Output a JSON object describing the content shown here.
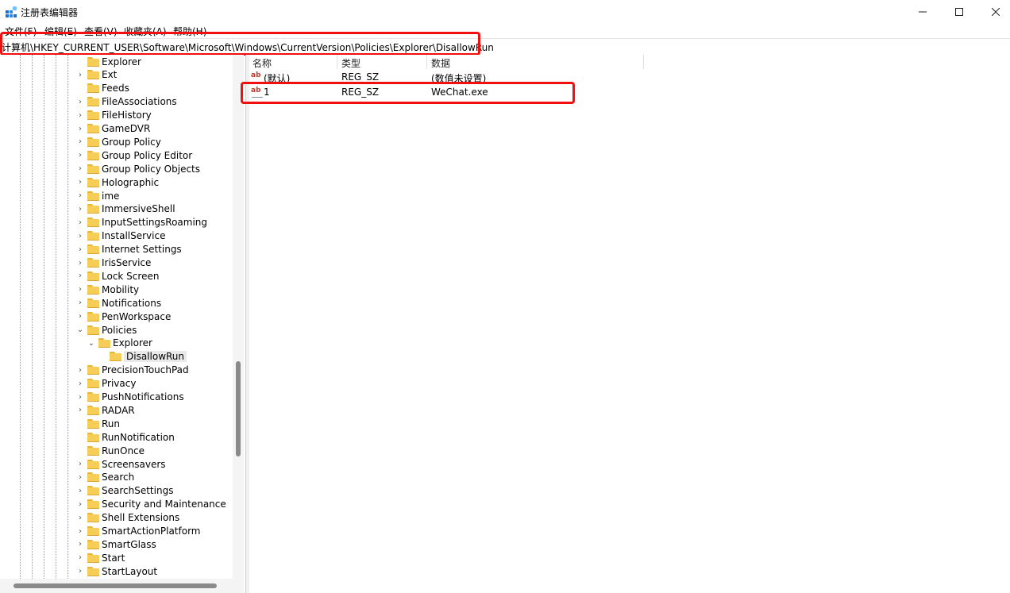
{
  "window": {
    "title": "注册表编辑器"
  },
  "menu": [
    "文件(F)",
    "编辑(E)",
    "查看(V)",
    "收藏夹(A)",
    "帮助(H)"
  ],
  "address": {
    "path": "计算机\\HKEY_CURRENT_USER\\Software\\Microsoft\\Windows\\CurrentVersion\\Policies\\Explorer\\DisallowRun"
  },
  "tree": [
    {
      "label": "Explorer",
      "level": 0,
      "expander": "none"
    },
    {
      "label": "Ext",
      "level": 0,
      "expander": "collapsed"
    },
    {
      "label": "Feeds",
      "level": 0,
      "expander": "none"
    },
    {
      "label": "FileAssociations",
      "level": 0,
      "expander": "collapsed"
    },
    {
      "label": "FileHistory",
      "level": 0,
      "expander": "collapsed"
    },
    {
      "label": "GameDVR",
      "level": 0,
      "expander": "collapsed"
    },
    {
      "label": "Group Policy",
      "level": 0,
      "expander": "collapsed"
    },
    {
      "label": "Group Policy Editor",
      "level": 0,
      "expander": "collapsed"
    },
    {
      "label": "Group Policy Objects",
      "level": 0,
      "expander": "collapsed"
    },
    {
      "label": "Holographic",
      "level": 0,
      "expander": "collapsed"
    },
    {
      "label": "ime",
      "level": 0,
      "expander": "collapsed"
    },
    {
      "label": "ImmersiveShell",
      "level": 0,
      "expander": "collapsed"
    },
    {
      "label": "InputSettingsRoaming",
      "level": 0,
      "expander": "collapsed"
    },
    {
      "label": "InstallService",
      "level": 0,
      "expander": "collapsed"
    },
    {
      "label": "Internet Settings",
      "level": 0,
      "expander": "collapsed"
    },
    {
      "label": "IrisService",
      "level": 0,
      "expander": "collapsed"
    },
    {
      "label": "Lock Screen",
      "level": 0,
      "expander": "collapsed"
    },
    {
      "label": "Mobility",
      "level": 0,
      "expander": "collapsed"
    },
    {
      "label": "Notifications",
      "level": 0,
      "expander": "collapsed"
    },
    {
      "label": "PenWorkspace",
      "level": 0,
      "expander": "collapsed"
    },
    {
      "label": "Policies",
      "level": 0,
      "expander": "expanded"
    },
    {
      "label": "Explorer",
      "level": 1,
      "expander": "expanded"
    },
    {
      "label": "DisallowRun",
      "level": 2,
      "expander": "none",
      "selected": true
    },
    {
      "label": "PrecisionTouchPad",
      "level": 0,
      "expander": "collapsed"
    },
    {
      "label": "Privacy",
      "level": 0,
      "expander": "collapsed"
    },
    {
      "label": "PushNotifications",
      "level": 0,
      "expander": "collapsed"
    },
    {
      "label": "RADAR",
      "level": 0,
      "expander": "collapsed"
    },
    {
      "label": "Run",
      "level": 0,
      "expander": "none"
    },
    {
      "label": "RunNotification",
      "level": 0,
      "expander": "none"
    },
    {
      "label": "RunOnce",
      "level": 0,
      "expander": "none"
    },
    {
      "label": "Screensavers",
      "level": 0,
      "expander": "collapsed"
    },
    {
      "label": "Search",
      "level": 0,
      "expander": "collapsed"
    },
    {
      "label": "SearchSettings",
      "level": 0,
      "expander": "collapsed"
    },
    {
      "label": "Security and Maintenance",
      "level": 0,
      "expander": "collapsed"
    },
    {
      "label": "Shell Extensions",
      "level": 0,
      "expander": "collapsed"
    },
    {
      "label": "SmartActionPlatform",
      "level": 0,
      "expander": "collapsed"
    },
    {
      "label": "SmartGlass",
      "level": 0,
      "expander": "collapsed"
    },
    {
      "label": "Start",
      "level": 0,
      "expander": "collapsed"
    },
    {
      "label": "StartLayout",
      "level": 0,
      "expander": "collapsed"
    }
  ],
  "list": {
    "columns": [
      "名称",
      "类型",
      "数据"
    ],
    "rows": [
      {
        "name": "(默认)",
        "type": "REG_SZ",
        "data": "(数值未设置)"
      },
      {
        "name": "1",
        "type": "REG_SZ",
        "data": "WeChat.exe"
      }
    ]
  },
  "icons": {
    "value": "ab-string-value-icon",
    "folder": "folder-icon"
  },
  "colors": {
    "highlight": "#f20f0f",
    "folder": "#f6ce57"
  }
}
